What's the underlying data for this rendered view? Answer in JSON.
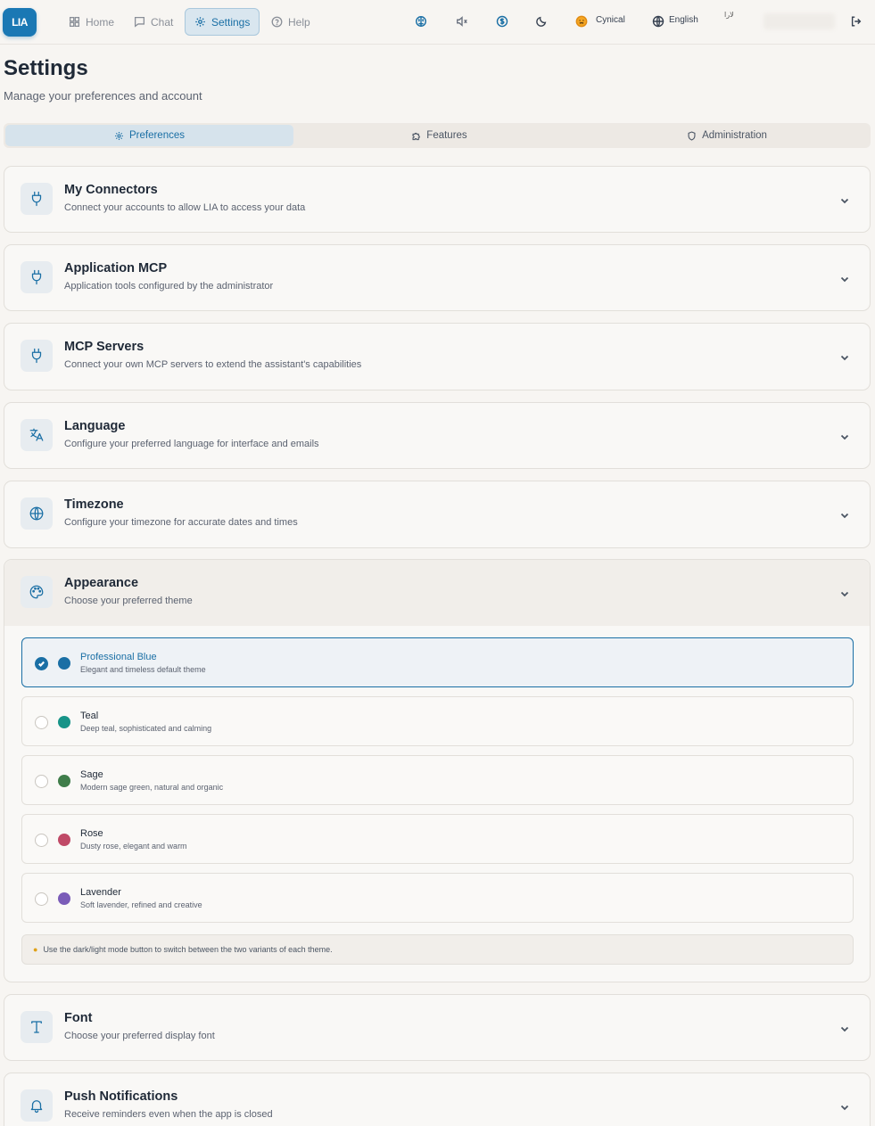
{
  "app": {
    "logo": "LIA"
  },
  "nav": [
    {
      "label": "Home",
      "icon": "grid-icon"
    },
    {
      "label": "Chat",
      "icon": "chat-icon"
    },
    {
      "label": "Settings",
      "icon": "gear-icon",
      "active": true
    },
    {
      "label": "Help",
      "icon": "help-circle-icon"
    }
  ],
  "toolbar": {
    "personality": "Cynical",
    "language": "English",
    "avatar_alt": "لارا"
  },
  "header": {
    "title": "Settings",
    "subtitle": "Manage your preferences and account"
  },
  "tabs": [
    {
      "label": "Preferences",
      "active": true
    },
    {
      "label": "Features"
    },
    {
      "label": "Administration"
    }
  ],
  "sections": {
    "connectors": {
      "title": "My Connectors",
      "desc": "Connect your accounts to allow LIA to access your data"
    },
    "app_mcp": {
      "title": "Application MCP",
      "desc": "Application tools configured by the administrator"
    },
    "mcp_servers": {
      "title": "MCP Servers",
      "desc": "Connect your own MCP servers to extend the assistant's capabilities"
    },
    "language": {
      "title": "Language",
      "desc": "Configure your preferred language for interface and emails"
    },
    "timezone": {
      "title": "Timezone",
      "desc": "Configure your timezone for accurate dates and times"
    },
    "appearance": {
      "title": "Appearance",
      "desc": "Choose your preferred theme"
    },
    "font": {
      "title": "Font",
      "desc": "Choose your preferred display font"
    },
    "push": {
      "title": "Push Notifications",
      "desc": "Receive reminders even when the app is closed"
    }
  },
  "themes": [
    {
      "name": "Professional Blue",
      "desc": "Elegant and timeless default theme",
      "color": "#1a6fa5",
      "selected": true
    },
    {
      "name": "Teal",
      "desc": "Deep teal, sophisticated and calming",
      "color": "#179488"
    },
    {
      "name": "Sage",
      "desc": "Modern sage green, natural and organic",
      "color": "#3f7d4a"
    },
    {
      "name": "Rose",
      "desc": "Dusty rose, elegant and warm",
      "color": "#c04a67"
    },
    {
      "name": "Lavender",
      "desc": "Soft lavender, refined and creative",
      "color": "#7a5cb8"
    }
  ],
  "appearance_tip": "Use the dark/light mode button to switch between the two variants of each theme.",
  "colors": {
    "accent": "#1a6fa5",
    "background": "#f7f5f2"
  }
}
